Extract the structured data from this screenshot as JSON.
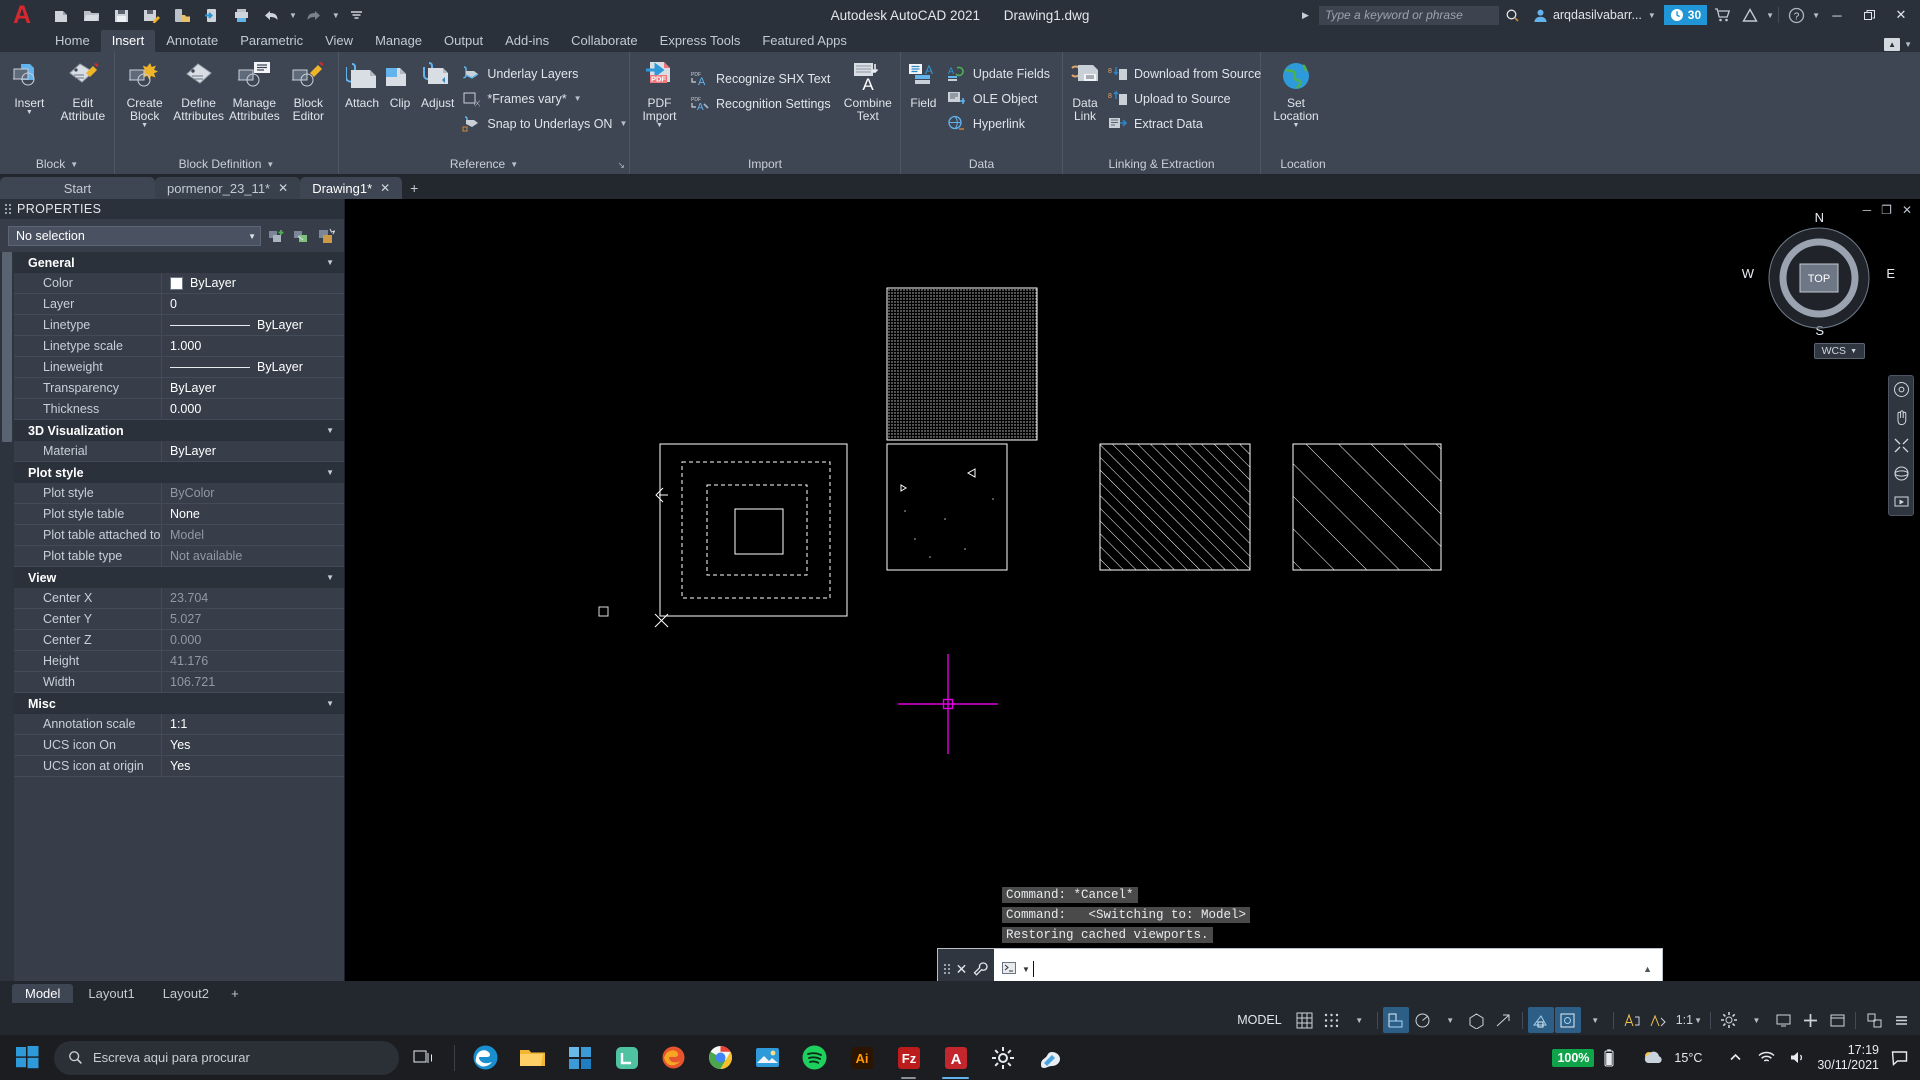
{
  "titlebar": {
    "app_title": "Autodesk AutoCAD 2021",
    "document_title": "Drawing1.dwg",
    "search_placeholder": "Type a keyword or phrase",
    "user_name": "arqdasilvabarr...",
    "trial_days": "30",
    "quick_access": [
      {
        "name": "new-file",
        "label": "New"
      },
      {
        "name": "open-file",
        "label": "Open"
      },
      {
        "name": "save-file",
        "label": "Save"
      },
      {
        "name": "save-as",
        "label": "Save As"
      },
      {
        "name": "save-to-web",
        "label": "Save to Web & Mobile"
      },
      {
        "name": "open-from-web",
        "label": "Open from Web & Mobile"
      },
      {
        "name": "plot",
        "label": "Plot"
      },
      {
        "name": "undo",
        "label": "Undo"
      },
      {
        "name": "redo",
        "label": "Redo"
      },
      {
        "name": "qat-customize",
        "label": "Customize"
      }
    ],
    "window_controls": {
      "minimize": "─",
      "restore": "❐",
      "close": "✕"
    }
  },
  "ribbon": {
    "tabs": [
      {
        "label": "Home",
        "active": false
      },
      {
        "label": "Insert",
        "active": true
      },
      {
        "label": "Annotate",
        "active": false
      },
      {
        "label": "Parametric",
        "active": false
      },
      {
        "label": "View",
        "active": false
      },
      {
        "label": "Manage",
        "active": false
      },
      {
        "label": "Output",
        "active": false
      },
      {
        "label": "Add-ins",
        "active": false
      },
      {
        "label": "Collaborate",
        "active": false
      },
      {
        "label": "Express Tools",
        "active": false
      },
      {
        "label": "Featured Apps",
        "active": false
      }
    ],
    "panels": {
      "block": {
        "title": "Block",
        "buttons": [
          {
            "label_line1": "Insert",
            "label_line2": "",
            "icon": "insert-block-icon"
          },
          {
            "label_line1": "Edit",
            "label_line2": "Attribute",
            "icon": "edit-attribute-icon"
          }
        ]
      },
      "block_definition": {
        "title": "Block Definition",
        "buttons": [
          {
            "label_line1": "Create",
            "label_line2": "Block",
            "icon": "create-block-icon"
          },
          {
            "label_line1": "Define",
            "label_line2": "Attributes",
            "icon": "define-attributes-icon"
          },
          {
            "label_line1": "Manage",
            "label_line2": "Attributes",
            "icon": "manage-attributes-icon"
          },
          {
            "label_line1": "Block",
            "label_line2": "Editor",
            "icon": "block-editor-icon"
          }
        ]
      },
      "reference": {
        "title": "Reference",
        "big_buttons": [
          {
            "label_line1": "Attach",
            "label_line2": "",
            "icon": "attach-icon"
          },
          {
            "label_line1": "Clip",
            "label_line2": "",
            "icon": "clip-icon"
          },
          {
            "label_line1": "Adjust",
            "label_line2": "",
            "icon": "adjust-icon"
          }
        ],
        "small_buttons": [
          {
            "label": "Underlay Layers",
            "icon": "underlay-layers-icon"
          },
          {
            "label": "*Frames vary*",
            "icon": "frames-vary-icon"
          },
          {
            "label": "Snap to Underlays ON",
            "icon": "snap-underlays-icon"
          }
        ]
      },
      "import": {
        "title": "Import",
        "big_buttons": [
          {
            "label_line1": "PDF",
            "label_line2": "Import",
            "icon": "pdf-import-icon"
          },
          {
            "label_line1": "Combine",
            "label_line2": "Text",
            "icon": "combine-text-icon"
          }
        ],
        "small_buttons": [
          {
            "label": "Recognize SHX Text",
            "icon": "recognize-shx-text-icon"
          },
          {
            "label": "Recognition Settings",
            "icon": "recognition-settings-icon"
          }
        ]
      },
      "data": {
        "title": "Data",
        "big_buttons": [
          {
            "label_line1": "Field",
            "label_line2": "",
            "icon": "field-icon"
          }
        ],
        "small_buttons": [
          {
            "label": "Update Fields",
            "icon": "update-fields-icon"
          },
          {
            "label": "OLE Object",
            "icon": "ole-object-icon"
          },
          {
            "label": "Hyperlink",
            "icon": "hyperlink-icon"
          }
        ]
      },
      "linking": {
        "title": "Linking & Extraction",
        "big_buttons": [
          {
            "label_line1": "Data",
            "label_line2": "Link",
            "icon": "data-link-icon"
          }
        ],
        "small_buttons": [
          {
            "label": "Download from Source",
            "icon": "download-from-source-icon"
          },
          {
            "label": "Upload to Source",
            "icon": "upload-to-source-icon"
          },
          {
            "label": "Extract  Data",
            "icon": "extract-data-icon"
          }
        ]
      },
      "location": {
        "title": "Location",
        "big_buttons": [
          {
            "label_line1": "Set",
            "label_line2": "Location",
            "icon": "set-location-icon"
          }
        ]
      }
    }
  },
  "file_tabs": [
    {
      "label": "Start",
      "active": false,
      "closable": false
    },
    {
      "label": "pormenor_23_11*",
      "active": false,
      "closable": true
    },
    {
      "label": "Drawing1*",
      "active": true,
      "closable": true
    }
  ],
  "properties": {
    "panel_title": "PROPERTIES",
    "selection": "No selection",
    "groups": [
      {
        "name": "General",
        "rows": [
          {
            "key": "Color",
            "value": "ByLayer",
            "kind": "swatch"
          },
          {
            "key": "Layer",
            "value": "0",
            "kind": "text"
          },
          {
            "key": "Linetype",
            "value": "ByLayer",
            "kind": "line"
          },
          {
            "key": "Linetype scale",
            "value": "1.000",
            "kind": "text"
          },
          {
            "key": "Lineweight",
            "value": "ByLayer",
            "kind": "line"
          },
          {
            "key": "Transparency",
            "value": "ByLayer",
            "kind": "text"
          },
          {
            "key": "Thickness",
            "value": "0.000",
            "kind": "text"
          }
        ]
      },
      {
        "name": "3D Visualization",
        "rows": [
          {
            "key": "Material",
            "value": "ByLayer",
            "kind": "text"
          }
        ]
      },
      {
        "name": "Plot style",
        "rows": [
          {
            "key": "Plot style",
            "value": "ByColor",
            "kind": "dim"
          },
          {
            "key": "Plot style table",
            "value": "None",
            "kind": "text"
          },
          {
            "key": "Plot table attached to",
            "value": "Model",
            "kind": "dim"
          },
          {
            "key": "Plot table type",
            "value": "Not available",
            "kind": "dim"
          }
        ]
      },
      {
        "name": "View",
        "rows": [
          {
            "key": "Center X",
            "value": "23.704",
            "kind": "dim"
          },
          {
            "key": "Center Y",
            "value": "5.027",
            "kind": "dim"
          },
          {
            "key": "Center Z",
            "value": "0.000",
            "kind": "dim"
          },
          {
            "key": "Height",
            "value": "41.176",
            "kind": "dim"
          },
          {
            "key": "Width",
            "value": "106.721",
            "kind": "dim"
          }
        ]
      },
      {
        "name": "Misc",
        "rows": [
          {
            "key": "Annotation scale",
            "value": "1:1",
            "kind": "text"
          },
          {
            "key": "UCS icon On",
            "value": "Yes",
            "kind": "text"
          },
          {
            "key": "UCS icon at origin",
            "value": "Yes",
            "kind": "text"
          }
        ]
      }
    ]
  },
  "canvas": {
    "viewcube": {
      "top": "TOP",
      "north": "N",
      "south": "S",
      "east": "E",
      "west": "W"
    },
    "wcs_label": "WCS",
    "command_history": [
      "Command: *Cancel*",
      "Command:   <Switching to: Model>",
      "Restoring cached viewports."
    ],
    "command_prompt": "",
    "window_buttons": {
      "minimize": "─",
      "restore": "❐",
      "close": "✕"
    }
  },
  "layout_tabs": [
    {
      "label": "Model",
      "active": true
    },
    {
      "label": "Layout1",
      "active": false
    },
    {
      "label": "Layout2",
      "active": false
    }
  ],
  "statusbar": {
    "space_label": "MODEL",
    "scale": "1:1",
    "items": [
      {
        "name": "grid-display",
        "label": "Display drawing grid"
      },
      {
        "name": "snap-mode",
        "label": "Snap mode"
      },
      {
        "name": "ortho-mode",
        "label": "Ortho mode"
      },
      {
        "name": "polar-tracking",
        "label": "Polar tracking"
      },
      {
        "name": "object-snap",
        "label": "Object snap"
      },
      {
        "name": "object-snap-tracking",
        "label": "Object snap tracking"
      },
      {
        "name": "lineweight",
        "label": "Show lineweight"
      },
      {
        "name": "transparency",
        "label": "Transparency"
      },
      {
        "name": "selection-cycling",
        "label": "Selection cycling"
      },
      {
        "name": "annotation-visibility",
        "label": "Annotation visibility"
      },
      {
        "name": "autoscale",
        "label": "Autoscale"
      }
    ]
  },
  "taskbar": {
    "search_placeholder": "Escreva aqui para procurar",
    "apps": [
      {
        "name": "task-view",
        "label": "Task View"
      },
      {
        "name": "edge",
        "label": "Microsoft Edge"
      },
      {
        "name": "file-explorer",
        "label": "File Explorer"
      },
      {
        "name": "microsoft-store",
        "label": "Microsoft Store"
      },
      {
        "name": "line-app",
        "label": "LINE"
      },
      {
        "name": "firefox",
        "label": "Firefox"
      },
      {
        "name": "chrome",
        "label": "Google Chrome"
      },
      {
        "name": "photos",
        "label": "Photos"
      },
      {
        "name": "spotify",
        "label": "Spotify"
      },
      {
        "name": "illustrator",
        "label": "Adobe Illustrator"
      },
      {
        "name": "filezilla",
        "label": "FileZilla"
      },
      {
        "name": "autocad",
        "label": "AutoCAD"
      },
      {
        "name": "settings",
        "label": "Settings"
      },
      {
        "name": "paint",
        "label": "Paint"
      }
    ],
    "battery_percent": "100%",
    "temperature": "15°C",
    "time": "17:19",
    "date": "30/11/2021"
  }
}
